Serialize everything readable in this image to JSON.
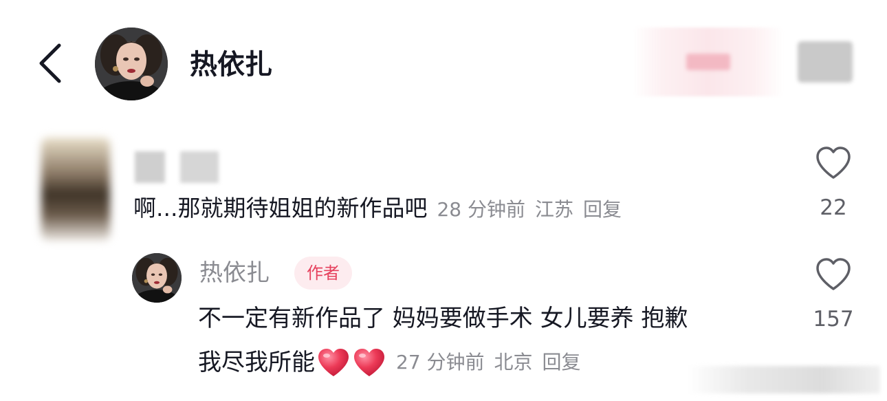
{
  "header": {
    "username": "热依扎",
    "back_icon": "chevron-left-icon"
  },
  "comment": {
    "text": "啊...那就期待姐姐的新作品吧",
    "time": "28 分钟前",
    "location": "江苏",
    "reply_label": "回复",
    "likes": "22"
  },
  "reply": {
    "username": "热依扎",
    "author_badge": "作者",
    "line1": "不一定有新作品了 妈妈要做手术 女儿要养 抱歉",
    "line2": "我尽我所能",
    "emojis": [
      "heart-emoji",
      "heart-emoji"
    ],
    "time": "27 分钟前",
    "location": "北京",
    "reply_label": "回复",
    "likes": "157"
  },
  "colors": {
    "text_primary": "#161823",
    "text_secondary": "#8a8b91",
    "badge_bg": "#fdecef",
    "badge_text": "#e6415d",
    "heart_emoji": "#e8324f"
  }
}
